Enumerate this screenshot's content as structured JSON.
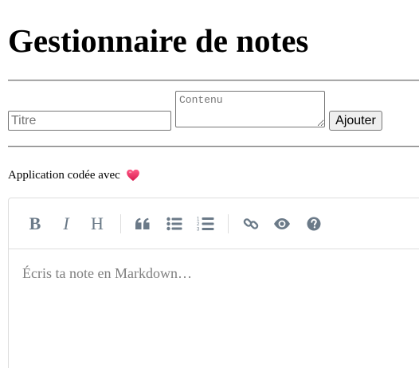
{
  "header": {
    "title": "Gestionnaire de notes"
  },
  "form": {
    "title_placeholder": "Titre",
    "title_value": "",
    "content_placeholder": "Contenu",
    "content_value": "",
    "add_label": "Ajouter"
  },
  "credit": {
    "text": "Application codée avec",
    "icon": "heart-icon",
    "icon_color": "#e8305c"
  },
  "editor": {
    "placeholder": "Écris ta note en Markdown…",
    "toolbar": {
      "bold_label": "B",
      "italic_label": "I",
      "heading_label": "H",
      "icons": [
        "bold-icon",
        "italic-icon",
        "heading-icon",
        "quote-icon",
        "unordered-list-icon",
        "ordered-list-icon",
        "link-icon",
        "preview-icon",
        "help-icon"
      ],
      "icon_color": "#6b7a88"
    }
  }
}
